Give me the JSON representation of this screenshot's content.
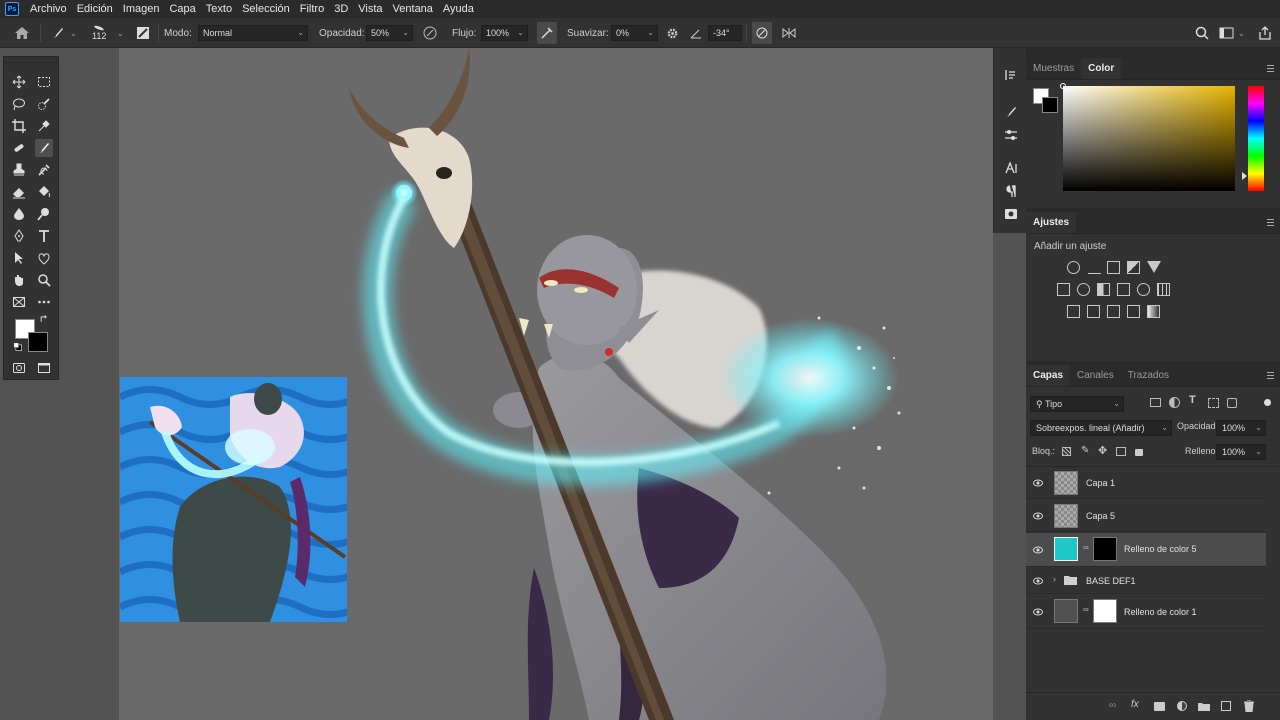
{
  "menubar": {
    "logo": "Ps",
    "items": [
      "Archivo",
      "Edición",
      "Imagen",
      "Capa",
      "Texto",
      "Selección",
      "Filtro",
      "3D",
      "Vista",
      "Ventana",
      "Ayuda"
    ]
  },
  "options": {
    "brush_size": "112",
    "mode_label": "Modo:",
    "mode_value": "Normal",
    "opacity_label": "Opacidad:",
    "opacity_value": "50%",
    "flow_label": "Flujo:",
    "flow_value": "100%",
    "smooth_label": "Suavizar:",
    "smooth_value": "0%",
    "angle_value": "-34°"
  },
  "color_panel": {
    "tabs": [
      "Muestras",
      "Color"
    ],
    "active_tab": "Color",
    "hue_color": "#e8b400"
  },
  "adjustments_panel": {
    "tab": "Ajustes",
    "subtitle": "Añadir un ajuste"
  },
  "layers_panel": {
    "tabs": [
      "Capas",
      "Canales",
      "Trazados"
    ],
    "filter_value": "Tipo",
    "blend_mode": "Sobreexpos. lineal (Añadir)",
    "opacity_label": "Opacidad:",
    "opacity_value": "100%",
    "lock_label": "Bloq.:",
    "fill_label": "Relleno:",
    "fill_value": "100%",
    "layers": [
      {
        "name": "Capa 1",
        "selected": false
      },
      {
        "name": "Capa 5",
        "selected": false
      },
      {
        "name": "Relleno de color 5",
        "selected": true,
        "fill": "#1ec8c8"
      },
      {
        "name": "BASE DEF1",
        "selected": false
      },
      {
        "name": "Relleno de color 1",
        "selected": false,
        "fill": "#505050"
      }
    ]
  },
  "colors": {
    "accent_cyan": "#5ff4ff",
    "app_bg": "#535353",
    "panel_bg": "#323232"
  }
}
